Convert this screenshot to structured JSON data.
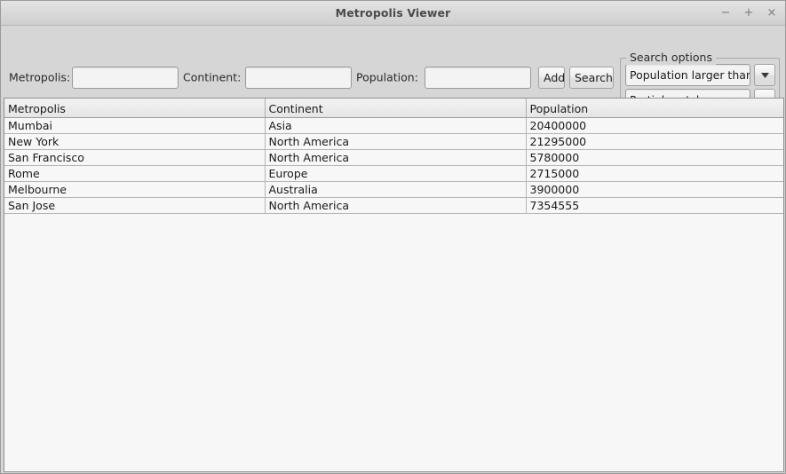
{
  "window": {
    "title": "Metropolis Viewer",
    "buttons": [
      {
        "name": "minimize-button",
        "glyph": "−"
      },
      {
        "name": "maximize-button",
        "glyph": "+"
      },
      {
        "name": "close-button",
        "glyph": "×"
      }
    ]
  },
  "form": {
    "metropolis_label": "Metropolis:",
    "metropolis_value": "",
    "metropolis_placeholder": "",
    "continent_label": "Continent:",
    "continent_value": "",
    "continent_placeholder": "",
    "population_label": "Population:",
    "population_value": "",
    "population_placeholder": "",
    "add_button": "Add",
    "search_button": "Search"
  },
  "search_options": {
    "group_label": "Search options",
    "criteria_selected": "Population larger than",
    "match_selected": "Partial match"
  },
  "table": {
    "columns": [
      "Metropolis",
      "Continent",
      "Population"
    ],
    "rows": [
      [
        "Mumbai",
        "Asia",
        "20400000"
      ],
      [
        "New York",
        "North America",
        "21295000"
      ],
      [
        "San Francisco",
        "North America",
        "5780000"
      ],
      [
        "Rome",
        "Europe",
        "2715000"
      ],
      [
        "Melbourne",
        "Australia",
        "3900000"
      ],
      [
        "San Jose",
        "North America",
        "7354555"
      ]
    ]
  },
  "colors": {
    "window_bg": "#d6d6d6",
    "table_bg": "#f7f7f7",
    "border": "#9a9a9a",
    "text": "#1a1a1a",
    "title_text": "#4a4a4a"
  }
}
